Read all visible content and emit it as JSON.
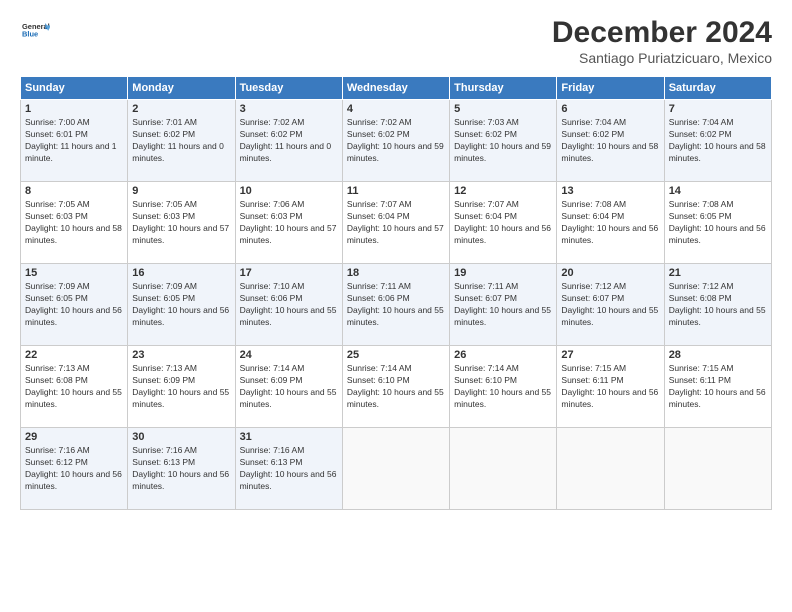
{
  "logo": {
    "general": "General",
    "blue": "Blue"
  },
  "header": {
    "month": "December 2024",
    "location": "Santiago Puriatzicuaro, Mexico"
  },
  "weekdays": [
    "Sunday",
    "Monday",
    "Tuesday",
    "Wednesday",
    "Thursday",
    "Friday",
    "Saturday"
  ],
  "weeks": [
    [
      {
        "day": "1",
        "sunrise": "Sunrise: 7:00 AM",
        "sunset": "Sunset: 6:01 PM",
        "daylight": "Daylight: 11 hours and 1 minute."
      },
      {
        "day": "2",
        "sunrise": "Sunrise: 7:01 AM",
        "sunset": "Sunset: 6:02 PM",
        "daylight": "Daylight: 11 hours and 0 minutes."
      },
      {
        "day": "3",
        "sunrise": "Sunrise: 7:02 AM",
        "sunset": "Sunset: 6:02 PM",
        "daylight": "Daylight: 11 hours and 0 minutes."
      },
      {
        "day": "4",
        "sunrise": "Sunrise: 7:02 AM",
        "sunset": "Sunset: 6:02 PM",
        "daylight": "Daylight: 10 hours and 59 minutes."
      },
      {
        "day": "5",
        "sunrise": "Sunrise: 7:03 AM",
        "sunset": "Sunset: 6:02 PM",
        "daylight": "Daylight: 10 hours and 59 minutes."
      },
      {
        "day": "6",
        "sunrise": "Sunrise: 7:04 AM",
        "sunset": "Sunset: 6:02 PM",
        "daylight": "Daylight: 10 hours and 58 minutes."
      },
      {
        "day": "7",
        "sunrise": "Sunrise: 7:04 AM",
        "sunset": "Sunset: 6:02 PM",
        "daylight": "Daylight: 10 hours and 58 minutes."
      }
    ],
    [
      {
        "day": "8",
        "sunrise": "Sunrise: 7:05 AM",
        "sunset": "Sunset: 6:03 PM",
        "daylight": "Daylight: 10 hours and 58 minutes."
      },
      {
        "day": "9",
        "sunrise": "Sunrise: 7:05 AM",
        "sunset": "Sunset: 6:03 PM",
        "daylight": "Daylight: 10 hours and 57 minutes."
      },
      {
        "day": "10",
        "sunrise": "Sunrise: 7:06 AM",
        "sunset": "Sunset: 6:03 PM",
        "daylight": "Daylight: 10 hours and 57 minutes."
      },
      {
        "day": "11",
        "sunrise": "Sunrise: 7:07 AM",
        "sunset": "Sunset: 6:04 PM",
        "daylight": "Daylight: 10 hours and 57 minutes."
      },
      {
        "day": "12",
        "sunrise": "Sunrise: 7:07 AM",
        "sunset": "Sunset: 6:04 PM",
        "daylight": "Daylight: 10 hours and 56 minutes."
      },
      {
        "day": "13",
        "sunrise": "Sunrise: 7:08 AM",
        "sunset": "Sunset: 6:04 PM",
        "daylight": "Daylight: 10 hours and 56 minutes."
      },
      {
        "day": "14",
        "sunrise": "Sunrise: 7:08 AM",
        "sunset": "Sunset: 6:05 PM",
        "daylight": "Daylight: 10 hours and 56 minutes."
      }
    ],
    [
      {
        "day": "15",
        "sunrise": "Sunrise: 7:09 AM",
        "sunset": "Sunset: 6:05 PM",
        "daylight": "Daylight: 10 hours and 56 minutes."
      },
      {
        "day": "16",
        "sunrise": "Sunrise: 7:09 AM",
        "sunset": "Sunset: 6:05 PM",
        "daylight": "Daylight: 10 hours and 56 minutes."
      },
      {
        "day": "17",
        "sunrise": "Sunrise: 7:10 AM",
        "sunset": "Sunset: 6:06 PM",
        "daylight": "Daylight: 10 hours and 55 minutes."
      },
      {
        "day": "18",
        "sunrise": "Sunrise: 7:11 AM",
        "sunset": "Sunset: 6:06 PM",
        "daylight": "Daylight: 10 hours and 55 minutes."
      },
      {
        "day": "19",
        "sunrise": "Sunrise: 7:11 AM",
        "sunset": "Sunset: 6:07 PM",
        "daylight": "Daylight: 10 hours and 55 minutes."
      },
      {
        "day": "20",
        "sunrise": "Sunrise: 7:12 AM",
        "sunset": "Sunset: 6:07 PM",
        "daylight": "Daylight: 10 hours and 55 minutes."
      },
      {
        "day": "21",
        "sunrise": "Sunrise: 7:12 AM",
        "sunset": "Sunset: 6:08 PM",
        "daylight": "Daylight: 10 hours and 55 minutes."
      }
    ],
    [
      {
        "day": "22",
        "sunrise": "Sunrise: 7:13 AM",
        "sunset": "Sunset: 6:08 PM",
        "daylight": "Daylight: 10 hours and 55 minutes."
      },
      {
        "day": "23",
        "sunrise": "Sunrise: 7:13 AM",
        "sunset": "Sunset: 6:09 PM",
        "daylight": "Daylight: 10 hours and 55 minutes."
      },
      {
        "day": "24",
        "sunrise": "Sunrise: 7:14 AM",
        "sunset": "Sunset: 6:09 PM",
        "daylight": "Daylight: 10 hours and 55 minutes."
      },
      {
        "day": "25",
        "sunrise": "Sunrise: 7:14 AM",
        "sunset": "Sunset: 6:10 PM",
        "daylight": "Daylight: 10 hours and 55 minutes."
      },
      {
        "day": "26",
        "sunrise": "Sunrise: 7:14 AM",
        "sunset": "Sunset: 6:10 PM",
        "daylight": "Daylight: 10 hours and 55 minutes."
      },
      {
        "day": "27",
        "sunrise": "Sunrise: 7:15 AM",
        "sunset": "Sunset: 6:11 PM",
        "daylight": "Daylight: 10 hours and 56 minutes."
      },
      {
        "day": "28",
        "sunrise": "Sunrise: 7:15 AM",
        "sunset": "Sunset: 6:11 PM",
        "daylight": "Daylight: 10 hours and 56 minutes."
      }
    ],
    [
      {
        "day": "29",
        "sunrise": "Sunrise: 7:16 AM",
        "sunset": "Sunset: 6:12 PM",
        "daylight": "Daylight: 10 hours and 56 minutes."
      },
      {
        "day": "30",
        "sunrise": "Sunrise: 7:16 AM",
        "sunset": "Sunset: 6:13 PM",
        "daylight": "Daylight: 10 hours and 56 minutes."
      },
      {
        "day": "31",
        "sunrise": "Sunrise: 7:16 AM",
        "sunset": "Sunset: 6:13 PM",
        "daylight": "Daylight: 10 hours and 56 minutes."
      },
      null,
      null,
      null,
      null
    ]
  ]
}
